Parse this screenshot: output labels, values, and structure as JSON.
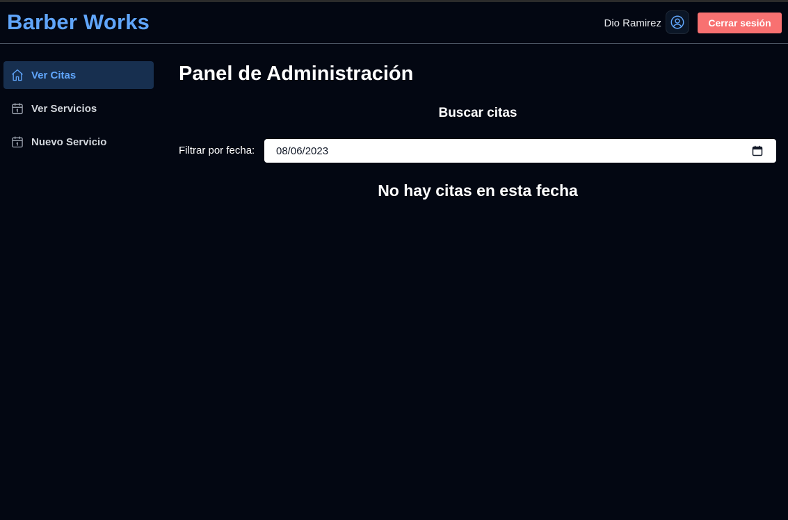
{
  "header": {
    "brand": "Barber Works",
    "user_name": "Dio Ramirez",
    "user_icon": "user-circle-icon",
    "logout_label": "Cerrar sesión"
  },
  "sidebar": {
    "items": [
      {
        "label": "Ver Citas",
        "icon": "home-icon",
        "active": true
      },
      {
        "label": "Ver Servicios",
        "icon": "calendar-icon",
        "active": false
      },
      {
        "label": "Nuevo Servicio",
        "icon": "calendar-icon",
        "active": false
      }
    ]
  },
  "main": {
    "title": "Panel de Administración",
    "section_title": "Buscar citas",
    "filter_label": "Filtrar por fecha:",
    "date_value": "08/06/2023",
    "empty_message": "No hay citas en esta fecha"
  },
  "colors": {
    "background": "#030712",
    "brand": "#60a5fa",
    "active_bg": "#172f4f",
    "logout": "#f87171"
  }
}
